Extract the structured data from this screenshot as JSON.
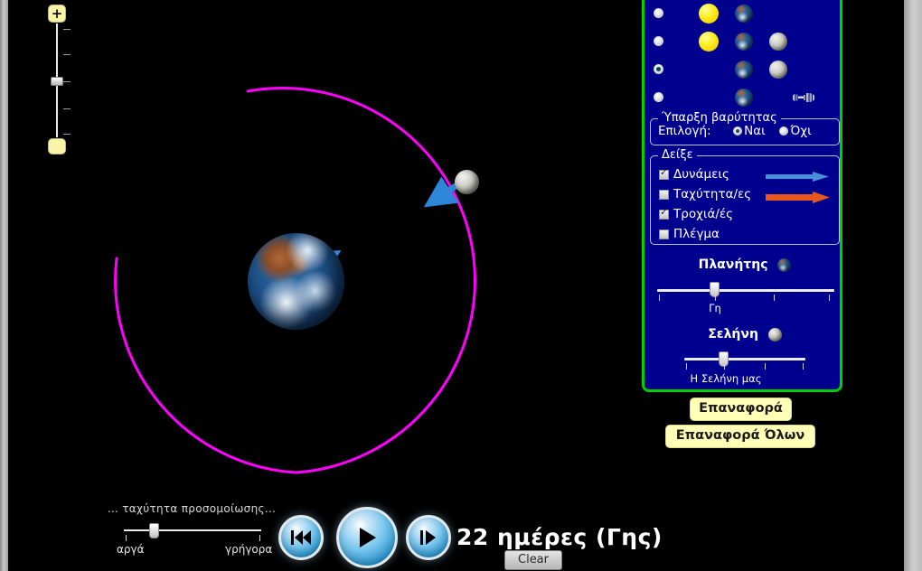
{
  "sim": {
    "zoom": {
      "plus_label": "+",
      "minus_label": "",
      "plus_icon": "zoom-in-icon",
      "minus_icon": "zoom-out-icon"
    },
    "orbit_color": "#ff00ff",
    "bodies": [
      {
        "name": "earth",
        "label": "Γη",
        "force_arrow_color": "#2f86d8"
      },
      {
        "name": "moon",
        "label": "Η Σελήνη μας",
        "force_arrow_color": "#2f86d8"
      }
    ]
  },
  "speed": {
    "title": "... ταχύτητα προσομοίωσης...",
    "slow_label": "αργά",
    "fast_label": "γρήγορα",
    "value_percent": 19
  },
  "transport": {
    "rewind_label": "rewind",
    "play_label": "play",
    "step_label": "step",
    "rewind_icon": "rewind-icon",
    "play_icon": "play-icon",
    "step_icon": "step-forward-icon",
    "day_counter": "22 ημέρες (Γης)",
    "clear_label": "Clear"
  },
  "panel": {
    "background_color": "#00008f",
    "border_color": "#00d000",
    "modes": [
      {
        "name": "sun-earth",
        "selected": false,
        "icons": [
          "sun-icon",
          "earth-icon"
        ]
      },
      {
        "name": "sun-earth-moon",
        "selected": false,
        "icons": [
          "sun-icon",
          "earth-icon",
          "moon-icon"
        ]
      },
      {
        "name": "earth-moon",
        "selected": true,
        "icons": [
          "earth-icon",
          "moon-icon"
        ]
      },
      {
        "name": "earth-space-station",
        "selected": false,
        "icons": [
          "earth-icon",
          "space-station-icon"
        ]
      }
    ],
    "gravity": {
      "legend": "Ύπαρξη βαρύτητας",
      "prompt": "Επιλογή:",
      "yes_label": "Ναι",
      "no_label": "Όχι",
      "selected": "yes"
    },
    "show": {
      "legend": "Δείξε",
      "items": [
        {
          "name": "forces",
          "label": "Δυνάμεις",
          "checked": true,
          "arrow_color": "#4a90d9"
        },
        {
          "name": "velocities",
          "label": "Ταχύτητα/ες",
          "checked": false,
          "arrow_color": "#e8581c"
        },
        {
          "name": "paths",
          "label": "Τροχιά/ές",
          "checked": true,
          "arrow_color": null
        },
        {
          "name": "grid",
          "label": "Πλέγμα",
          "checked": false,
          "arrow_color": null
        }
      ]
    },
    "planet_slider": {
      "title": "Πλανήτης",
      "caption": "Γη",
      "value_percent": 33
    },
    "moon_slider": {
      "title": "Σελήνη",
      "caption": "Η Σελήνη μας",
      "value_percent": 33
    }
  },
  "buttons": {
    "reset": "Επαναφορά",
    "reset_all": "Επαναφορά Όλων"
  }
}
